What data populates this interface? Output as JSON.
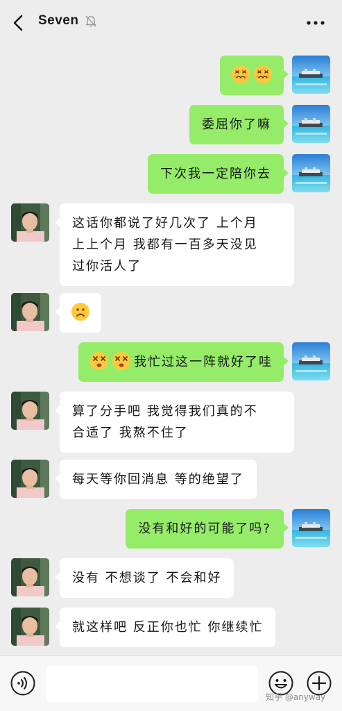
{
  "header": {
    "title": "Seven",
    "back_icon": "chevron-left-icon",
    "mute_icon": "bell-off-icon",
    "more_icon": "more-dots-icon"
  },
  "messages": [
    {
      "side": "me",
      "emojis": [
        "scream-face",
        "scream-face"
      ],
      "text": ""
    },
    {
      "side": "me",
      "text": "委屈你了嘛"
    },
    {
      "side": "me",
      "text": "下次我一定陪你去"
    },
    {
      "side": "peer",
      "text": "这话你都说了好几次了 上个月\n上上个月 我都有一百多天没见\n过你活人了"
    },
    {
      "side": "peer",
      "emojis": [
        "sad-face"
      ],
      "text": ""
    },
    {
      "side": "me",
      "emojis": [
        "dizzy-face",
        "dizzy-face"
      ],
      "text": "我忙过这一阵就好了哇"
    },
    {
      "side": "peer",
      "text": "算了分手吧 我觉得我们真的不\n合适了 我熬不住了"
    },
    {
      "side": "peer",
      "text": "每天等你回消息  等的绝望了"
    },
    {
      "side": "me",
      "text": "没有和好的可能了吗?"
    },
    {
      "side": "peer",
      "text": "没有 不想谈了 不会和好"
    },
    {
      "side": "peer",
      "text": "就这样吧 反正你也忙 你继续忙"
    }
  ],
  "input_bar": {
    "voice_icon": "voice-icon",
    "emoji_icon": "smile-icon",
    "plus_icon": "plus-circle-icon",
    "input_value": ""
  },
  "watermark": "知乎 @anyway",
  "colors": {
    "me_bubble": "#95ec69",
    "peer_bubble": "#ffffff",
    "background": "#ededed"
  }
}
